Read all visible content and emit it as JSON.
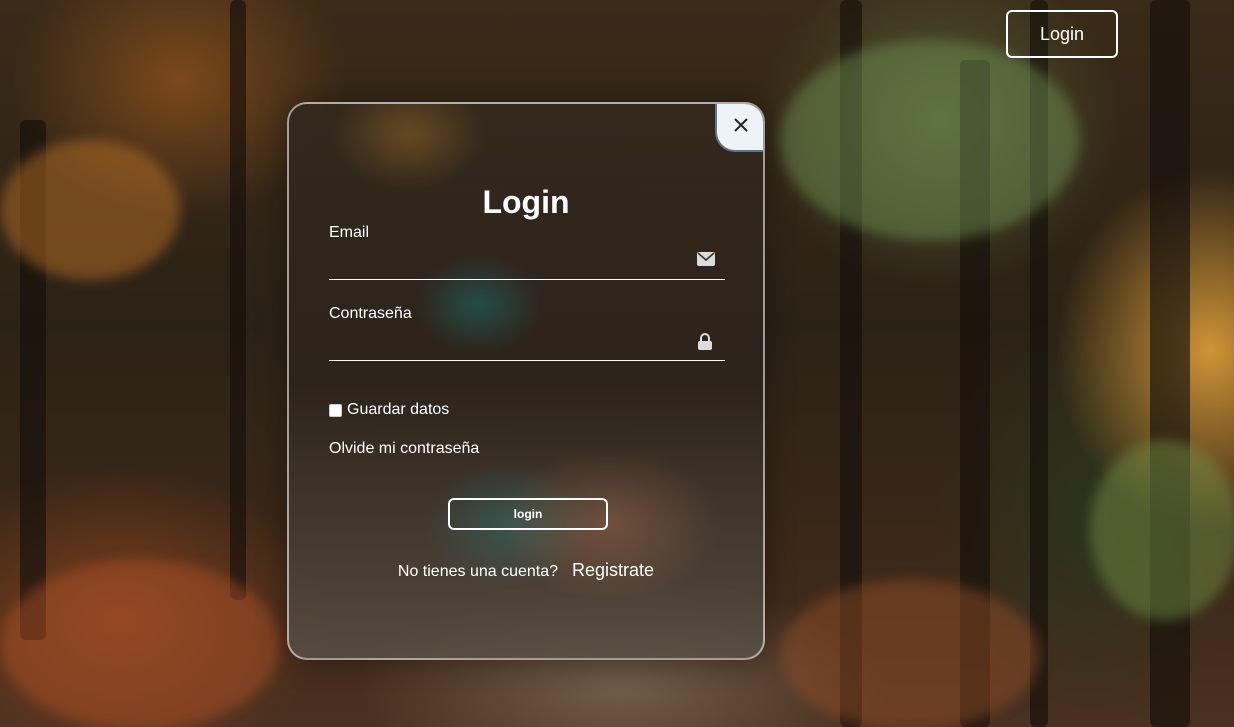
{
  "header": {
    "login_button_label": "Login"
  },
  "modal": {
    "close_icon": "close-icon",
    "title": "Login",
    "email": {
      "label": "Email",
      "value": "",
      "icon": "envelope-icon"
    },
    "password": {
      "label": "Contraseña",
      "value": "",
      "icon": "lock-icon"
    },
    "remember": {
      "label": "Guardar datos",
      "checked": false
    },
    "forgot_link": "Olvide mi contraseña",
    "submit_label": "login",
    "register": {
      "prompt": "No tienes una cuenta?",
      "link": "Registrate"
    }
  },
  "colors": {
    "close_button_bg": "#eef3f8",
    "text": "#ffffff",
    "accent_border": "#ffffff"
  }
}
